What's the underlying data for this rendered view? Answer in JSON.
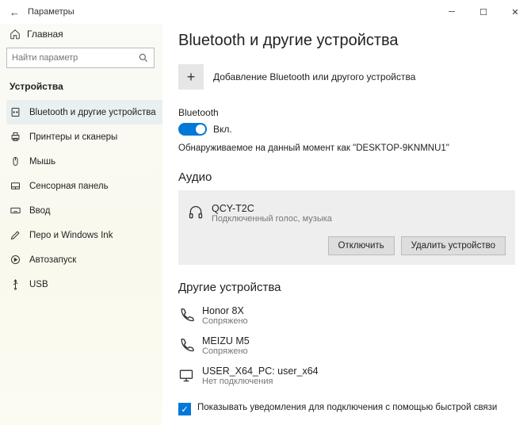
{
  "titlebar": {
    "title": "Параметры"
  },
  "home": {
    "label": "Главная"
  },
  "search": {
    "placeholder": "Найти параметр"
  },
  "sidebar": {
    "section": "Устройства",
    "items": [
      {
        "label": "Bluetooth и другие устройства"
      },
      {
        "label": "Принтеры и сканеры"
      },
      {
        "label": "Мышь"
      },
      {
        "label": "Сенсорная панель"
      },
      {
        "label": "Ввод"
      },
      {
        "label": "Перо и Windows Ink"
      },
      {
        "label": "Автозапуск"
      },
      {
        "label": "USB"
      }
    ]
  },
  "main": {
    "heading": "Bluetooth и другие устройства",
    "add_label": "Добавление Bluetooth или другого устройства",
    "bt_label": "Bluetooth",
    "bt_toggle": "Вкл.",
    "discoverable": "Обнаруживаемое на данный момент как \"DESKTOP-9KNMNU1\"",
    "audio_title": "Аудио",
    "audio_device": {
      "name": "QCY-T2C",
      "status": "Подключенный голос, музыка"
    },
    "btn_disconnect": "Отключить",
    "btn_remove": "Удалить устройство",
    "other_title": "Другие устройства",
    "other_devices": [
      {
        "name": "Honor 8X",
        "status": "Сопряжено"
      },
      {
        "name": "MEIZU M5",
        "status": "Сопряжено"
      },
      {
        "name": "USER_X64_PC: user_x64",
        "status": "Нет подключения"
      }
    ],
    "checkbox_label": "Показывать уведомления для подключения с помощью быстрой связи"
  }
}
